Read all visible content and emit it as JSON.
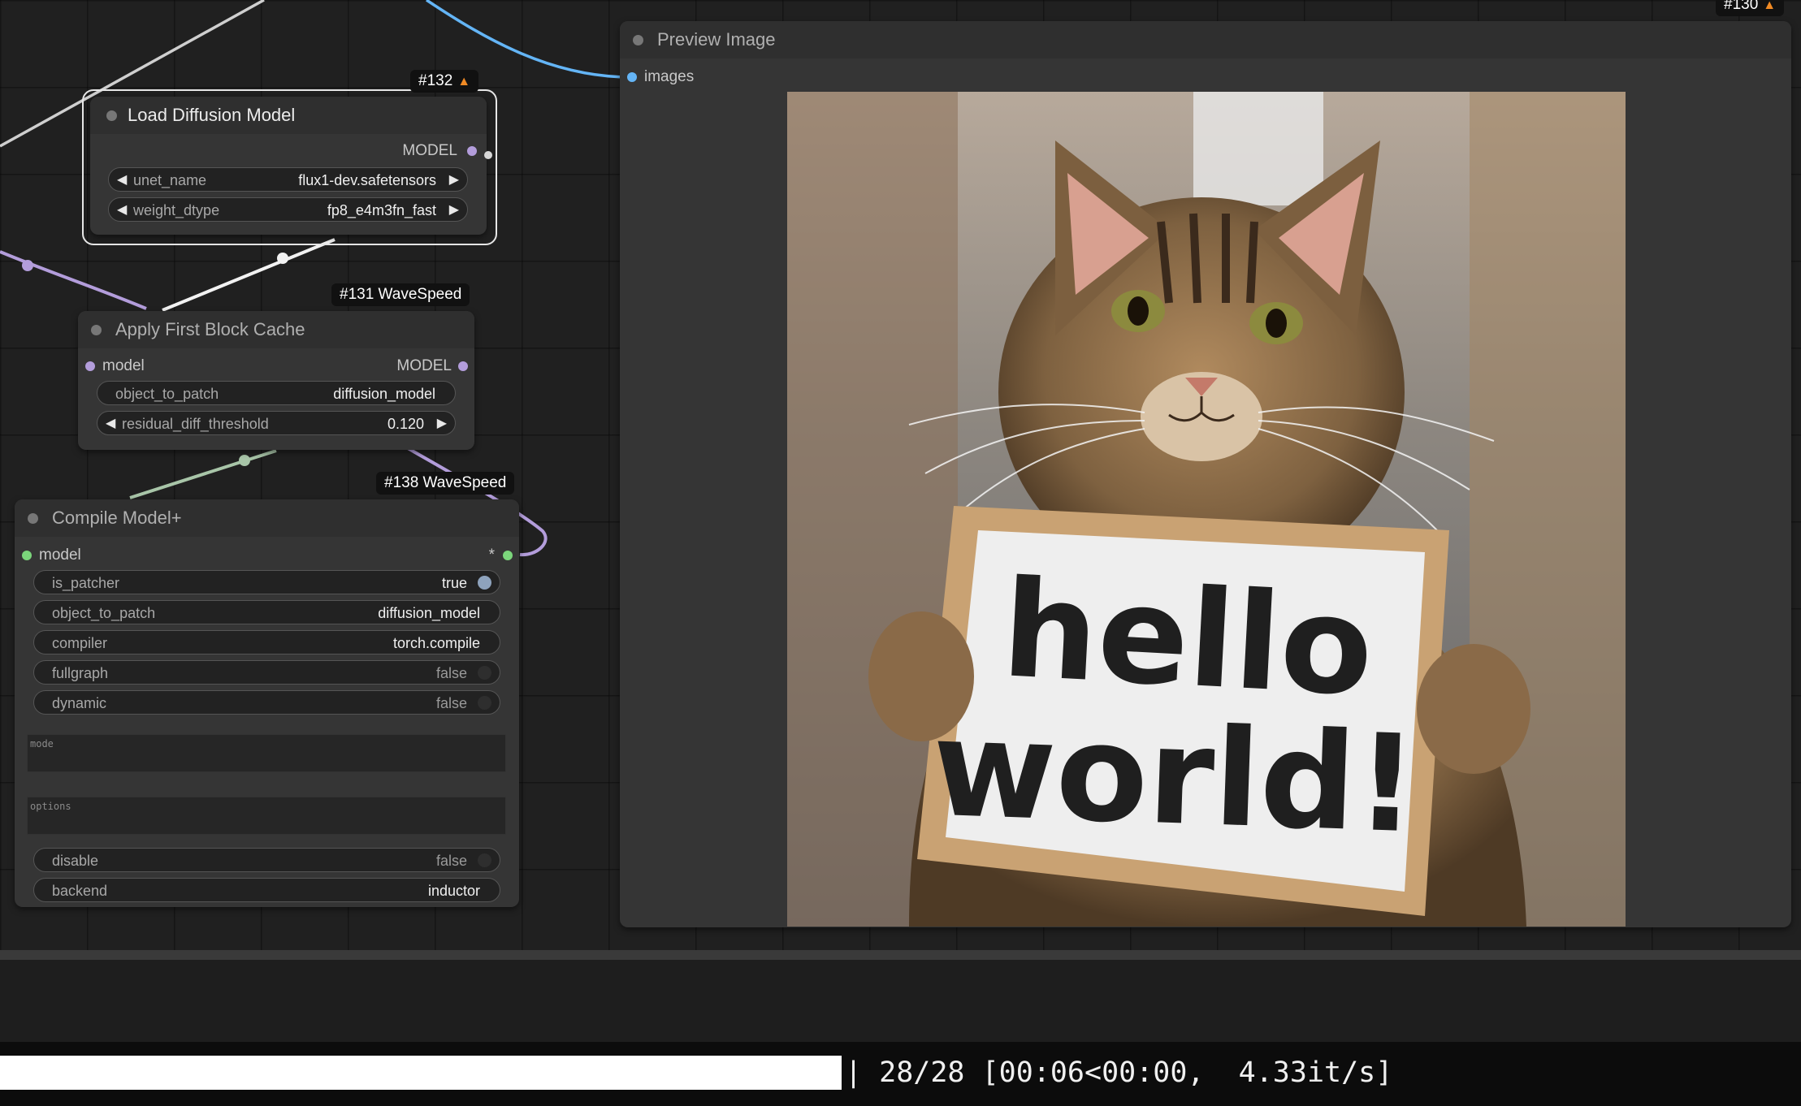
{
  "colors": {
    "model_socket": "#b39ddb",
    "image_socket": "#64b5f6",
    "compile_socket": "#7bd67b",
    "badge_fox": "#f08a24"
  },
  "badges": {
    "node_132": "#132",
    "node_131": "#131 WaveSpeed",
    "node_138": "#138 WaveSpeed",
    "node_130": "#130"
  },
  "load_diffusion": {
    "title": "Load Diffusion Model",
    "output": "MODEL",
    "unet_name": {
      "label": "unet_name",
      "value": "flux1-dev.safetensors"
    },
    "weight_dtype": {
      "label": "weight_dtype",
      "value": "fp8_e4m3fn_fast"
    }
  },
  "first_block_cache": {
    "title": "Apply First Block Cache",
    "input": "model",
    "output": "MODEL",
    "object_to_patch": {
      "label": "object_to_patch",
      "value": "diffusion_model"
    },
    "residual_diff_threshold": {
      "label": "residual_diff_threshold",
      "value": "0.120"
    }
  },
  "compile_model": {
    "title": "Compile Model+",
    "input": "model",
    "output": "*",
    "is_patcher": {
      "label": "is_patcher",
      "value": "true"
    },
    "object_to_patch": {
      "label": "object_to_patch",
      "value": "diffusion_model"
    },
    "compiler": {
      "label": "compiler",
      "value": "torch.compile"
    },
    "fullgraph": {
      "label": "fullgraph",
      "value": "false"
    },
    "dynamic": {
      "label": "dynamic",
      "value": "false"
    },
    "mode": {
      "placeholder": "mode"
    },
    "options": {
      "placeholder": "options"
    },
    "disable": {
      "label": "disable",
      "value": "false"
    },
    "backend": {
      "label": "backend",
      "value": "inductor"
    }
  },
  "preview": {
    "title": "Preview Image",
    "input": "images",
    "sign_line1": "hello",
    "sign_line2": "world!"
  },
  "terminal": {
    "progress_fraction": 1.0,
    "text": "| 28/28 [00:06<00:00,  4.33it/s]"
  }
}
